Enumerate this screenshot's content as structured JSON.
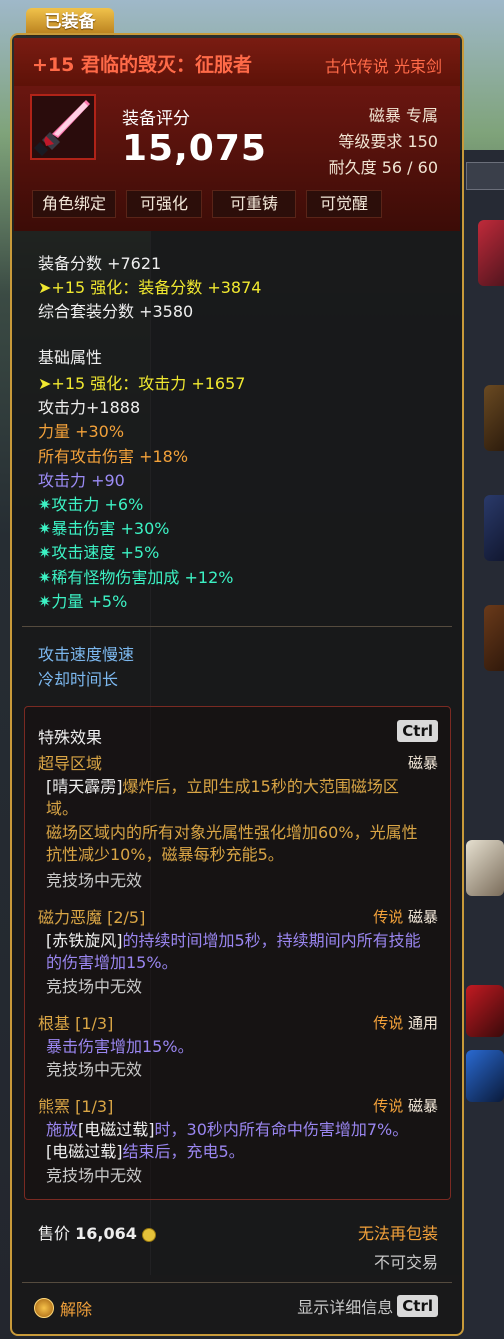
{
  "equipped_tab": "已装备",
  "item": {
    "name": "+15 君临的毁灭：征服者",
    "type": "古代传说 光束剑",
    "score_label": "装备评分",
    "score": "15,075",
    "exclusive": "磁暴 专属",
    "level_req": "等级要求 150",
    "durability": "耐久度 56 / 60",
    "badges": [
      "角色绑定",
      "可强化",
      "可重铸",
      "可觉醒"
    ]
  },
  "scores": {
    "equip_score": "装备分数 +7621",
    "enhance_score": "+15 强化：装备分数 +3874",
    "set_score": "综合套装分数 +3580"
  },
  "base_attrs": {
    "heading": "基础属性",
    "lines": [
      {
        "text": "+15 强化：攻击力 +1657",
        "color": "yellow",
        "arrow": true
      },
      {
        "text": "攻击力+1888",
        "color": "white"
      },
      {
        "text": "力量 +30%",
        "color": "orange"
      },
      {
        "text": "所有攻击伤害 +18%",
        "color": "orange"
      },
      {
        "text": "攻击力 +90",
        "color": "blue"
      },
      {
        "text": "攻击力 +6%",
        "color": "cyan",
        "star": true
      },
      {
        "text": "暴击伤害 +30%",
        "color": "cyan",
        "star": true
      },
      {
        "text": "攻击速度 +5%",
        "color": "cyan",
        "star": true
      },
      {
        "text": "稀有怪物伤害加成 +12%",
        "color": "cyan",
        "star": true
      },
      {
        "text": "力量 +5%",
        "color": "cyan",
        "star": true
      }
    ]
  },
  "traits": [
    "攻击速度慢速",
    "冷却时间长"
  ],
  "special": {
    "heading": "特殊效果",
    "hotkey": "Ctrl",
    "effects": [
      {
        "name": "超导区域",
        "legend": "",
        "class": "磁暴",
        "desc_html": "<span class='b'>[晴天霹雳]</span>爆炸后，立即生成15秒的大范围磁场区域。",
        "desc2": "磁场区域内的所有对象光属性强化增加60%，光属性抗性减少10%，磁暴每秒充能5。",
        "note": "竞技场中无效"
      },
      {
        "name": "磁力恶魔 [2/5]",
        "legend": "传说",
        "class": "磁暴",
        "desc_html": "<span class='b'>[赤铁旋风]</span>的持续时间增加5秒，持续期间内所有技能的伤害增加15%。",
        "note": "竞技场中无效"
      },
      {
        "name": "根基 [1/3]",
        "legend": "传说",
        "class": "通用",
        "desc_html": "暴击伤害增加15%。",
        "note": "竞技场中无效"
      },
      {
        "name": "熊罴 [1/3]",
        "legend": "传说",
        "class": "磁暴",
        "desc_html": "施放<span class='b'>[电磁过载]</span>时，30秒内所有命中伤害增加7%。<span class='b'>[电磁过载]</span>结束后，充电5。",
        "note": "竞技场中无效"
      }
    ]
  },
  "footer": {
    "price_label": "售价",
    "price": "16,064",
    "repack": "无法再包装",
    "trade": "不可交易",
    "unequip": "解除",
    "detail_label": "显示详细信息",
    "detail_key": "Ctrl"
  },
  "colors": {
    "border": "#c89a3a",
    "title_red": "#ff6a48",
    "attr_yellow": "#f0e830",
    "attr_orange": "#f2a13a",
    "attr_cyan": "#3cf2c4",
    "attr_blue": "#9c8cf6"
  }
}
